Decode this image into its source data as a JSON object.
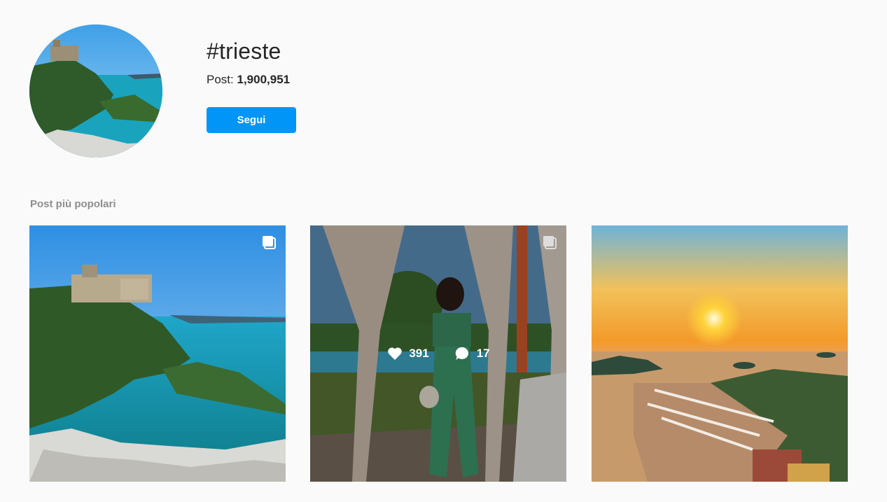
{
  "hashtag": {
    "title": "#trieste",
    "posts_label": "Post:",
    "posts_count": "1,900,951",
    "follow_label": "Segui"
  },
  "section_title": "Post più popolari",
  "posts": [
    {
      "image": "castle-coast-photo",
      "multi": true
    },
    {
      "image": "woman-curtains-photo",
      "multi": true,
      "likes": "391",
      "comments": "17"
    },
    {
      "image": "sunset-marina-photo",
      "multi": false
    }
  ],
  "colors": {
    "accent": "#0095f6",
    "background": "#fafafa",
    "muted": "#8e8e8e"
  }
}
